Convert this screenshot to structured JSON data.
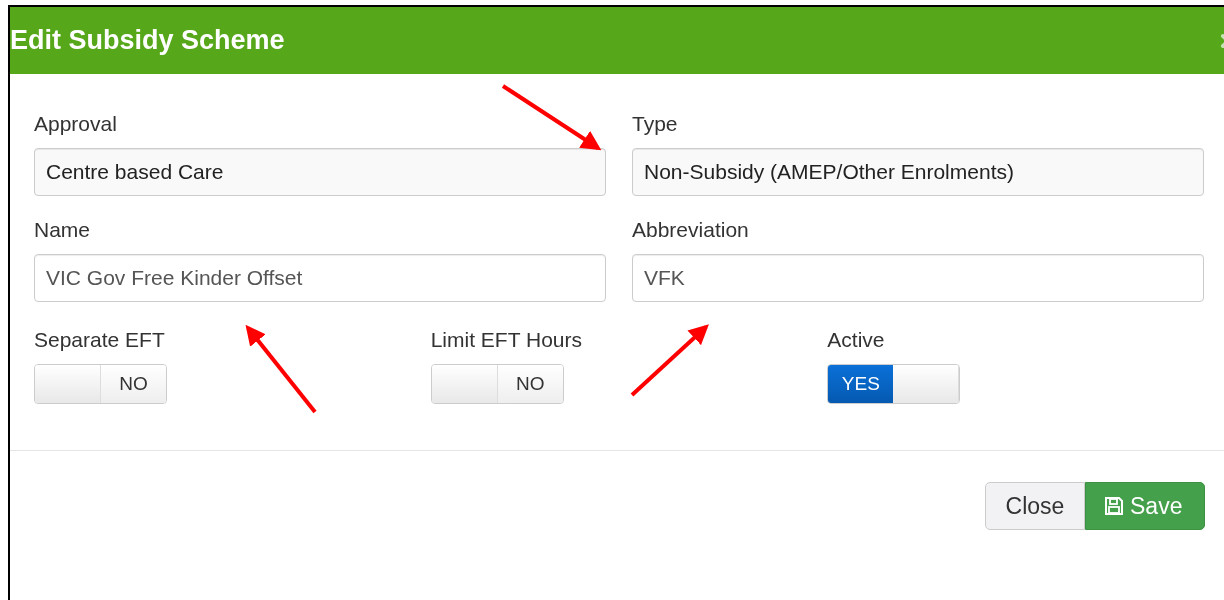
{
  "dialog": {
    "title": "Edit Subsidy Scheme"
  },
  "fields": [
    {
      "label": "Approval",
      "value": "Centre based Care",
      "disabled": true
    },
    {
      "label": "Type",
      "value": "Non-Subsidy (AMEP/Other Enrolments)",
      "disabled": true
    },
    {
      "label": "Name",
      "value": "VIC Gov Free Kinder Offset",
      "disabled": false
    },
    {
      "label": "Abbreviation",
      "value": "VFK",
      "disabled": false
    }
  ],
  "toggles": [
    {
      "label": "Separate EFT",
      "on": false,
      "text": "NO"
    },
    {
      "label": "Limit EFT Hours",
      "on": false,
      "text": "NO"
    },
    {
      "label": "Active",
      "on": true,
      "text": "YES"
    }
  ],
  "buttons": [
    {
      "label": "Close",
      "kind": "secondary"
    },
    {
      "label": "Save",
      "kind": "primary"
    }
  ]
}
